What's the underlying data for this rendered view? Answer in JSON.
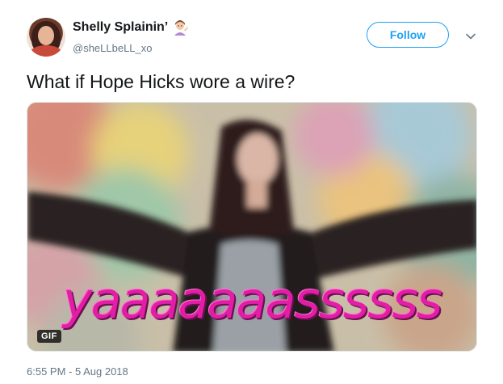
{
  "tweet": {
    "display_name": "Shelly Splainin’",
    "emoji": "woman-tipping-hand-icon",
    "handle": "@sheLLbeLL_xo",
    "follow_label": "Follow",
    "text": "What if Hope Hicks wore a wire?",
    "timestamp": "6:55 PM - 5 Aug 2018"
  },
  "media": {
    "type": "gif",
    "badge": "GIF",
    "caption": "yaaaaaaassssss"
  },
  "colors": {
    "accent": "#1da1f2",
    "caption": "#e21ea7",
    "secondary_text": "#657786"
  }
}
